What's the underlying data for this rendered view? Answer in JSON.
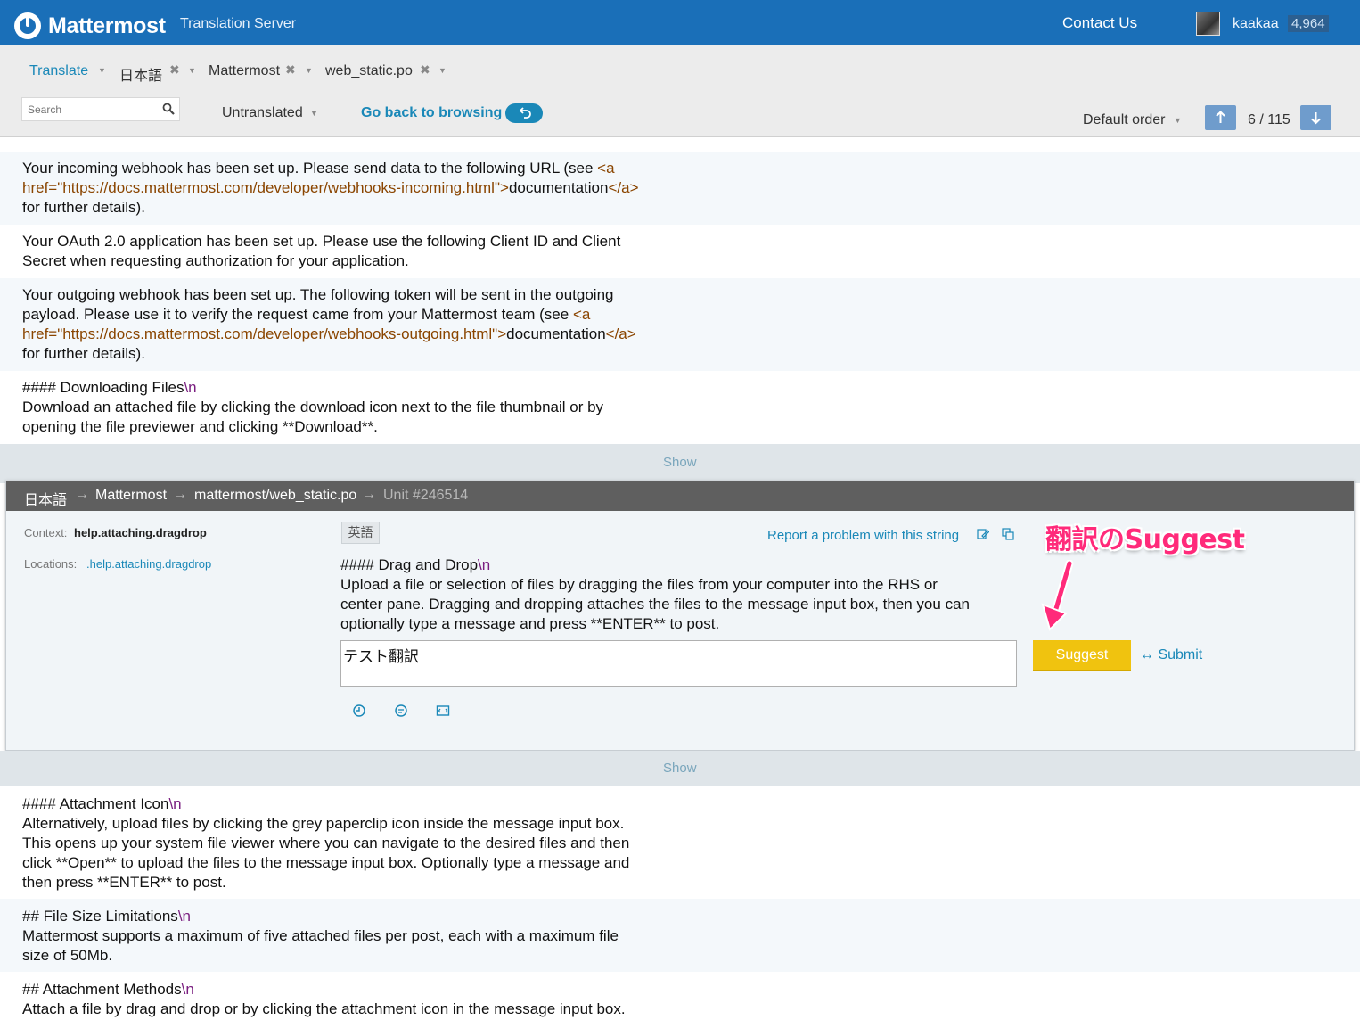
{
  "header": {
    "brand": "Mattermost",
    "subtitle": "Translation Server",
    "contact": "Contact Us",
    "username": "kaakaa",
    "score": "4,964"
  },
  "nav": {
    "translate": "Translate",
    "language": "日本語",
    "project": "Mattermost",
    "file": "web_static.po",
    "search_placeholder": "Search",
    "filter": "Untranslated",
    "back": "Go back to browsing",
    "order": "Default order",
    "counter": "6 / 115"
  },
  "units_before": [
    {
      "lines": [
        [
          {
            "t": "Your incoming webhook has been set up. Please send data to the following URL (see "
          },
          {
            "t": "<a",
            "k": "tag"
          }
        ],
        [
          {
            "t": "href=\"https://docs.mattermost.com/developer/webhooks-incoming.html\">",
            "k": "tag"
          },
          {
            "t": "documentation"
          },
          {
            "t": "</a>",
            "k": "tag"
          }
        ],
        [
          {
            "t": "for further details)."
          }
        ]
      ]
    },
    {
      "lines": [
        [
          {
            "t": "Your OAuth 2.0 application has been set up. Please use the following Client ID and Client"
          }
        ],
        [
          {
            "t": "Secret when requesting authorization for your application."
          }
        ]
      ]
    },
    {
      "lines": [
        [
          {
            "t": "Your outgoing webhook has been set up. The following token will be sent in the outgoing"
          }
        ],
        [
          {
            "t": "payload. Please use it to verify the request came from your Mattermost team (see "
          },
          {
            "t": "<a",
            "k": "tag"
          }
        ],
        [
          {
            "t": "href=\"https://docs.mattermost.com/developer/webhooks-outgoing.html\">",
            "k": "tag"
          },
          {
            "t": "documentation"
          },
          {
            "t": "</a>",
            "k": "tag"
          }
        ],
        [
          {
            "t": "for further details)."
          }
        ]
      ]
    },
    {
      "lines": [
        [
          {
            "t": "#### Downloading Files"
          },
          {
            "t": "\\n",
            "k": "esc"
          }
        ],
        [
          {
            "t": "Download an attached file by clicking the download icon next to the file thumbnail or by"
          }
        ],
        [
          {
            "t": "opening the file previewer and clicking **Download**."
          }
        ]
      ]
    }
  ],
  "show_label": "Show",
  "editor": {
    "breadcrumb": [
      "日本語",
      "Mattermost",
      "mattermost/web_static.po",
      "Unit #246514"
    ],
    "context_label": "Context:",
    "context_value": "help.attaching.dragdrop",
    "locations_label": "Locations:",
    "locations_value": ".help.attaching.dragdrop",
    "source_lang": "英語",
    "report": "Report a problem with this string",
    "source_lines": [
      [
        {
          "t": "#### Drag and Drop"
        },
        {
          "t": "\\n",
          "k": "esc"
        }
      ],
      [
        {
          "t": "Upload a file or selection of files by dragging the files from your computer into the RHS or"
        }
      ],
      [
        {
          "t": "center pane. Dragging and dropping attaches the files to the message input box, then you can"
        }
      ],
      [
        {
          "t": "optionally type a message and press **ENTER** to post."
        }
      ]
    ],
    "translation": "テスト翻訳",
    "suggest": "Suggest",
    "submit": "Submit",
    "submit_prefix": "↔"
  },
  "annotation": "翻訳のSuggest",
  "units_after": [
    {
      "lines": [
        [
          {
            "t": "#### Attachment Icon"
          },
          {
            "t": "\\n",
            "k": "esc"
          }
        ],
        [
          {
            "t": "Alternatively, upload files by clicking the grey paperclip icon inside the message input box."
          }
        ],
        [
          {
            "t": "This opens up your system file viewer where you can navigate to the desired files and then"
          }
        ],
        [
          {
            "t": "click **Open** to upload the files to the message input box. Optionally type a message and"
          }
        ],
        [
          {
            "t": "then press **ENTER** to post."
          }
        ]
      ]
    },
    {
      "lines": [
        [
          {
            "t": "## File Size Limitations"
          },
          {
            "t": "\\n",
            "k": "esc"
          }
        ],
        [
          {
            "t": "Mattermost supports a maximum of five attached files per post, each with a maximum file"
          }
        ],
        [
          {
            "t": "size of 50Mb."
          }
        ]
      ]
    },
    {
      "lines": [
        [
          {
            "t": "## Attachment Methods"
          },
          {
            "t": "\\n",
            "k": "esc"
          }
        ],
        [
          {
            "t": "Attach a file by drag and drop or by clicking the attachment icon in the message input box."
          }
        ]
      ]
    }
  ],
  "colors": {
    "header_bg": "#1a6fb8",
    "accent": "#1a88b8",
    "suggest": "#f0c30f",
    "annotation": "#ff2a7a"
  }
}
